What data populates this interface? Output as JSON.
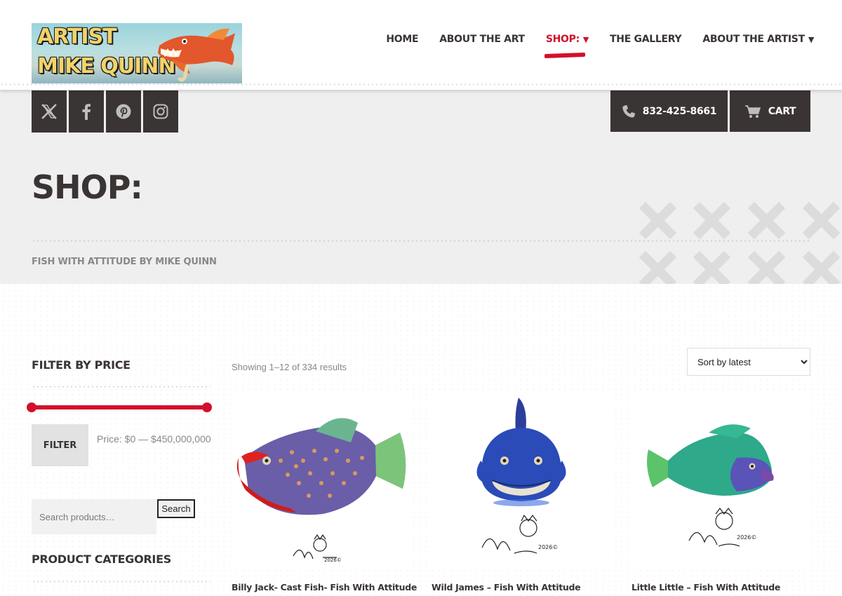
{
  "header": {
    "logo": {
      "line1": "ARTIST",
      "line2": "MIKE QUINN"
    },
    "nav": [
      {
        "label": "HOME",
        "has_dropdown": false,
        "active": false
      },
      {
        "label": "ABOUT THE ART",
        "has_dropdown": false,
        "active": false
      },
      {
        "label": "SHOP:",
        "has_dropdown": true,
        "active": true
      },
      {
        "label": "THE GALLERY",
        "has_dropdown": false,
        "active": false
      },
      {
        "label": "ABOUT THE ARTIST",
        "has_dropdown": true,
        "active": false
      }
    ]
  },
  "band": {
    "social": [
      {
        "icon": "x-twitter-icon"
      },
      {
        "icon": "facebook-icon"
      },
      {
        "icon": "pinterest-icon"
      },
      {
        "icon": "instagram-icon"
      }
    ],
    "phone": "832-425-8661",
    "cart_label": "CART",
    "page_title": "SHOP:",
    "subtitle": "FISH WITH ATTITUDE BY MIKE QUINN"
  },
  "sidebar": {
    "filter_heading": "FILTER BY PRICE",
    "filter_button": "FILTER",
    "price_label": "Price: $0 — $450,000,000",
    "search_placeholder": "Search products…",
    "search_button": "Search",
    "categories_heading": "PRODUCT CATEGORIES"
  },
  "shop": {
    "results_count": "Showing 1–12 of 334 results",
    "sort_selected": "Sort by latest",
    "products": [
      {
        "title": "Billy Jack- Cast Fish- Fish With Attitude"
      },
      {
        "title": "Wild James – Fish With Attitude"
      },
      {
        "title": "Little Little – Fish With Attitude"
      }
    ]
  },
  "colors": {
    "accent": "#d3102b",
    "dark": "#3a3434",
    "band_bg": "#efefef",
    "muted": "#8a8787"
  }
}
